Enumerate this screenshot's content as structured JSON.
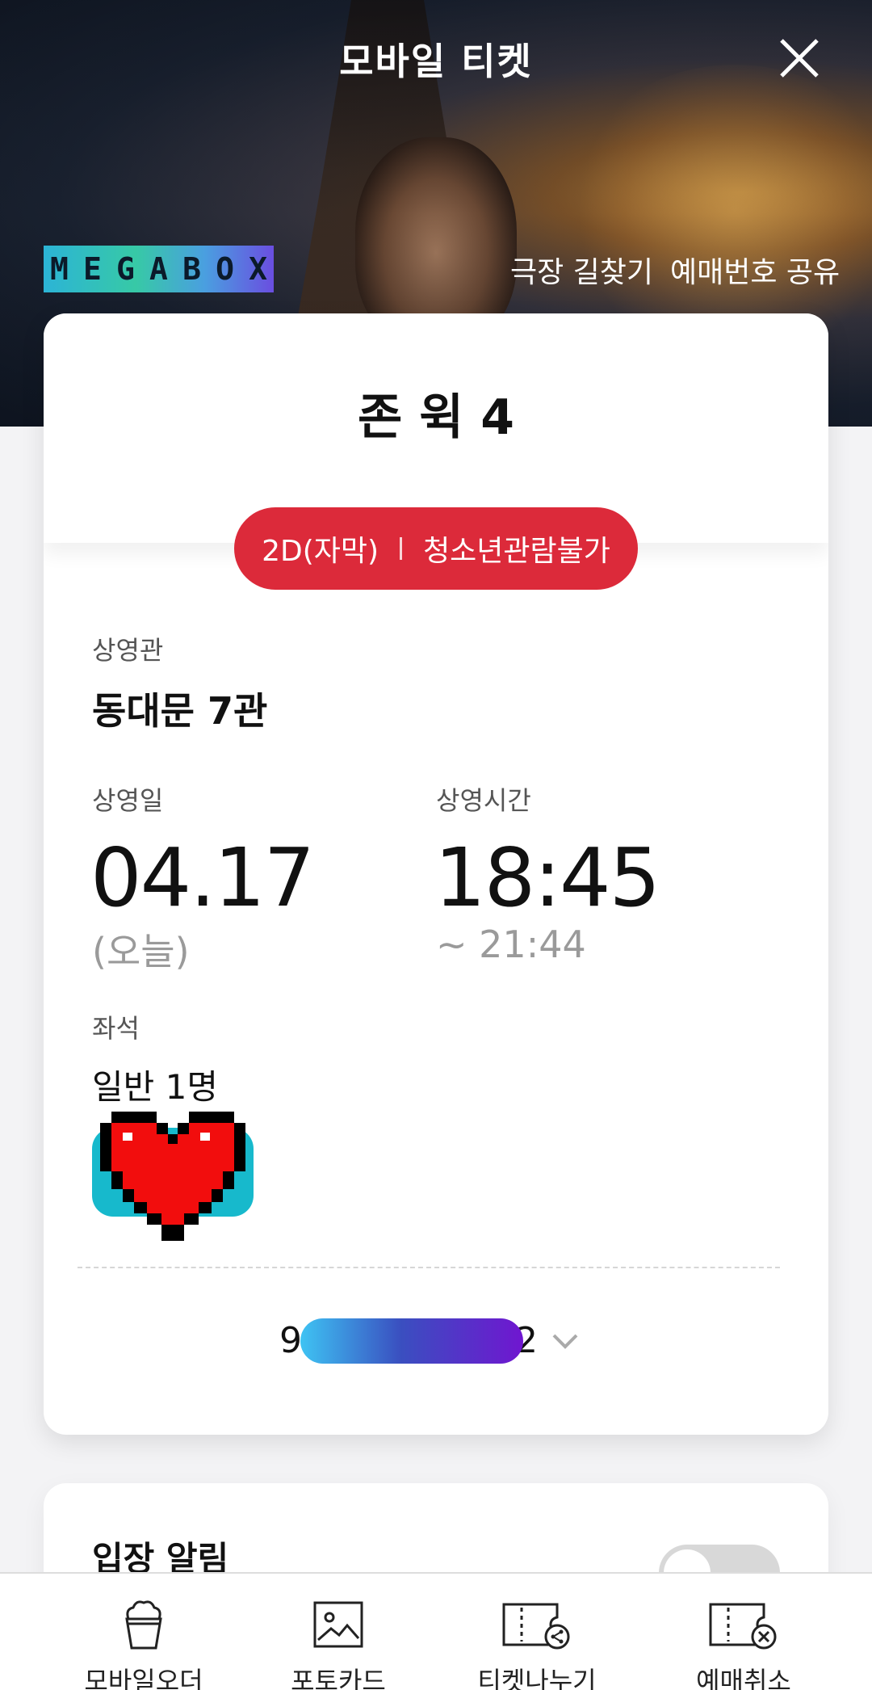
{
  "header": {
    "title": "모바일 티켓",
    "close_icon": "close-icon"
  },
  "hero": {
    "logo_letters": [
      "M",
      "E",
      "G",
      "A",
      "B",
      "O",
      "X"
    ],
    "links": [
      "극장 길찾기",
      "예매번호 공유"
    ]
  },
  "ticket": {
    "movie_title": "존 윅 4",
    "format": "2D(자막)",
    "rating": "청소년관람불가",
    "theater_label": "상영관",
    "theater_value": "동대문 7관",
    "date_label": "상영일",
    "date_value": "04.17",
    "date_sub": "(오늘)",
    "time_label": "상영시간",
    "time_value": "18:45",
    "time_end": "~  21:44",
    "seat_label": "좌석",
    "seat_value": "일반 1명",
    "booking_code_start": "9",
    "booking_code_end": "2"
  },
  "entry_alert": {
    "title": "입장 알림"
  },
  "bottom_nav": [
    {
      "label": "모바일오더",
      "icon": "popcorn-icon"
    },
    {
      "label": "포토카드",
      "icon": "photo-icon"
    },
    {
      "label": "티켓나누기",
      "icon": "ticket-share-icon"
    },
    {
      "label": "예매취소",
      "icon": "ticket-cancel-icon"
    }
  ],
  "colors": {
    "accent_red": "#dc2a3a",
    "code_gradient_start": "#3ec3f3",
    "code_gradient_end": "#7016d0"
  }
}
